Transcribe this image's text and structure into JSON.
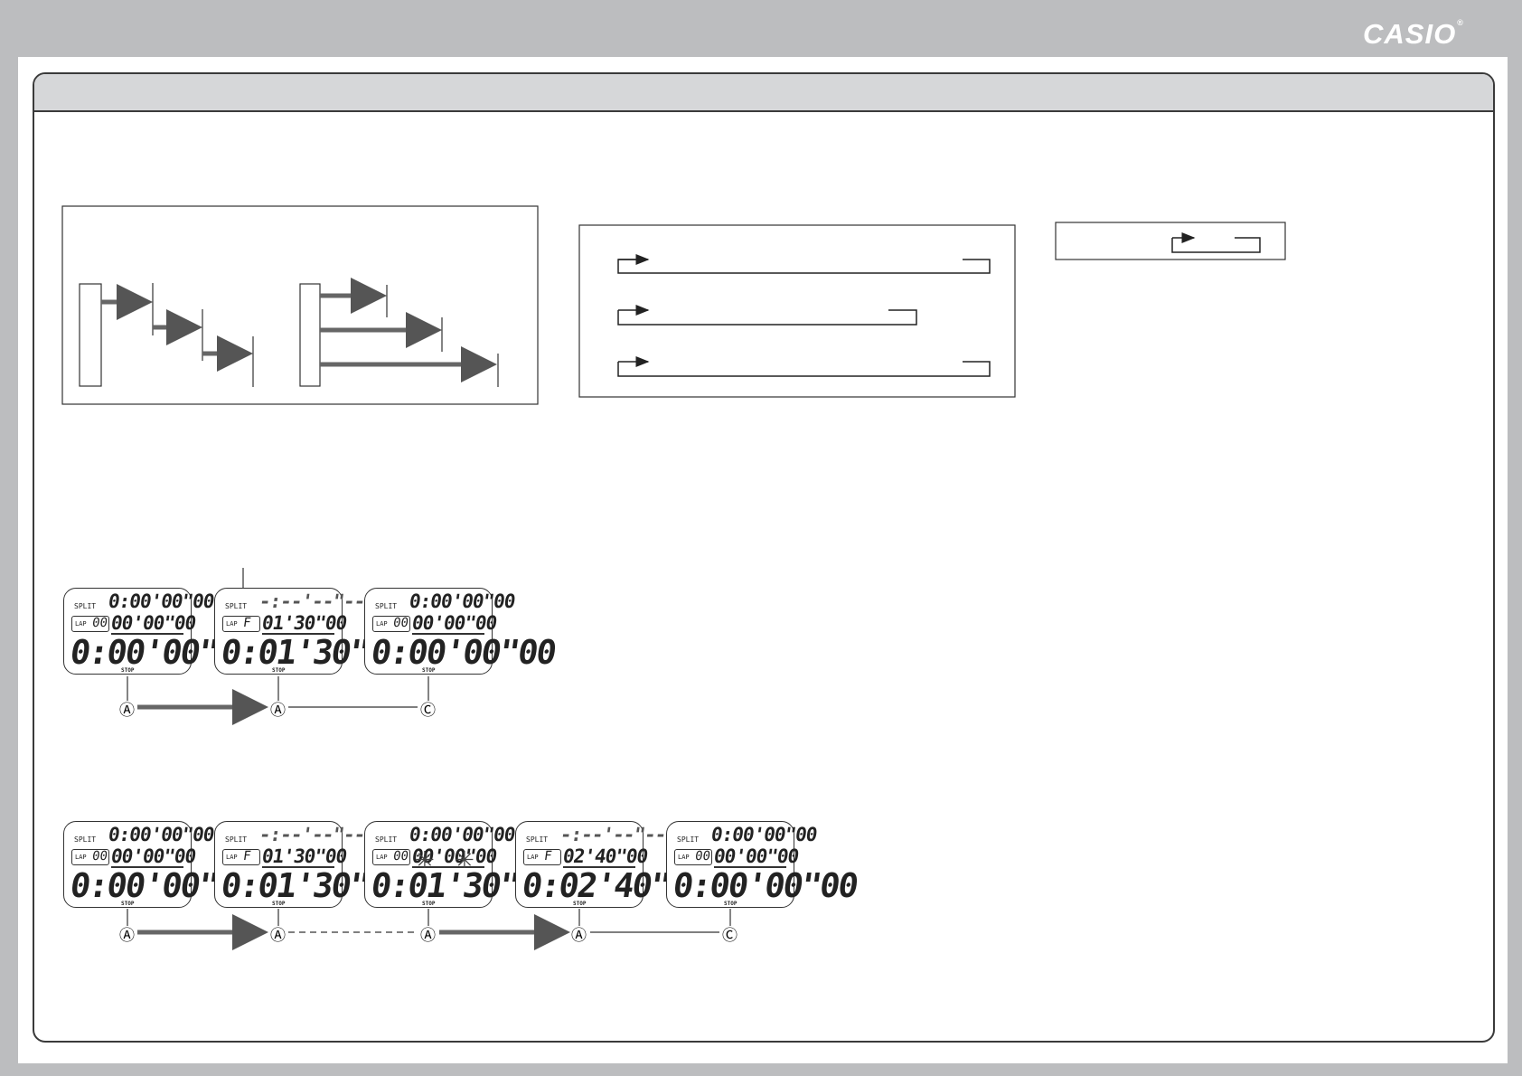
{
  "brand": {
    "logo_text": "CASIO",
    "registered_mark": "®"
  },
  "displays": {
    "labels": {
      "split": "SPLIT",
      "lap": "LAP",
      "stop": "STOP"
    },
    "sequence1": [
      {
        "split": "0:00'00\"00",
        "lap_no": "00",
        "lap": "00'00\"00",
        "main": "0:00'00\"00"
      },
      {
        "split": "-:--'--\"--",
        "lap_no": "F",
        "lap": "01'30\"00",
        "main": "0:01'30\"00"
      },
      {
        "split": "0:00'00\"00",
        "lap_no": "00",
        "lap": "00'00\"00",
        "main": "0:00'00\"00"
      }
    ],
    "sequence2": [
      {
        "split": "0:00'00\"00",
        "lap_no": "00",
        "lap": "00'00\"00",
        "main": "0:00'00\"00"
      },
      {
        "split": "-:--'--\"--",
        "lap_no": "F",
        "lap": "01'30\"00",
        "main": "0:01'30\"00"
      },
      {
        "split": "0:00'00\"00",
        "lap_no": "00",
        "lap": "00'00\"00",
        "main": "0:01'30\"00"
      },
      {
        "split": "-:--'--\"--",
        "lap_no": "F",
        "lap": "02'40\"00",
        "main": "0:02'40\"00"
      },
      {
        "split": "0:00'00\"00",
        "lap_no": "00",
        "lap": "00'00\"00",
        "main": "0:00'00\"00"
      }
    ]
  },
  "buttons": {
    "a": "Ⓐ",
    "c": "Ⓒ"
  }
}
